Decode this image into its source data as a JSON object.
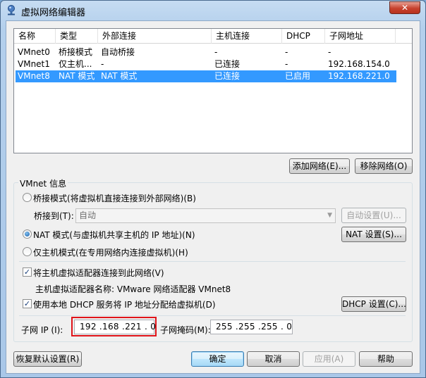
{
  "window": {
    "title": "虚拟网络编辑器",
    "close_glyph": "✕"
  },
  "table": {
    "headers": [
      "名称",
      "类型",
      "外部连接",
      "主机连接",
      "DHCP",
      "子网地址"
    ],
    "rows": [
      [
        "VMnet0",
        "桥接模式",
        "自动桥接",
        "-",
        "-",
        "-"
      ],
      [
        "VMnet1",
        "仅主机...",
        "-",
        "已连接",
        "-",
        "192.168.154.0"
      ],
      [
        "VMnet8",
        "NAT 模式",
        "NAT 模式",
        "已连接",
        "已启用",
        "192.168.221.0"
      ]
    ],
    "selected_row": 2
  },
  "buttons": {
    "add_network": "添加网络(E)...",
    "remove_network": "移除网络(O)",
    "auto_settings": "自动设置(U)...",
    "nat_settings": "NAT 设置(S)...",
    "dhcp_settings": "DHCP 设置(C)...",
    "restore_defaults": "恢复默认设置(R)",
    "ok": "确定",
    "cancel": "取消",
    "apply": "应用(A)",
    "help": "帮助"
  },
  "vmnet_info": {
    "group_title": "VMnet 信息",
    "bridged_label": "桥接模式(将虚拟机直接连接到外部网络)(B)",
    "bridged_to_label": "桥接到(T):",
    "bridged_to_value": "自动",
    "nat_label": "NAT 模式(与虚拟机共享主机的 IP 地址)(N)",
    "host_only_label": "仅主机模式(在专用网络内连接虚拟机)(H)",
    "selected_mode": "nat",
    "connect_adapter_label": "将主机虚拟适配器连接到此网络(V)",
    "connect_adapter_checked": true,
    "adapter_name_label": "主机虚拟适配器名称: VMware 网络适配器 VMnet8",
    "dhcp_label": "使用本地 DHCP 服务将 IP 地址分配给虚拟机(D)",
    "dhcp_checked": true,
    "subnet_ip_label": "子网 IP (I):",
    "subnet_ip_value": "192 .168 .221 . 0",
    "subnet_mask_label": "子网掩码(M):",
    "subnet_mask_value": "255 .255 .255 . 0"
  },
  "colors": {
    "selection": "#3399ff",
    "highlight_box": "#e0141a"
  }
}
